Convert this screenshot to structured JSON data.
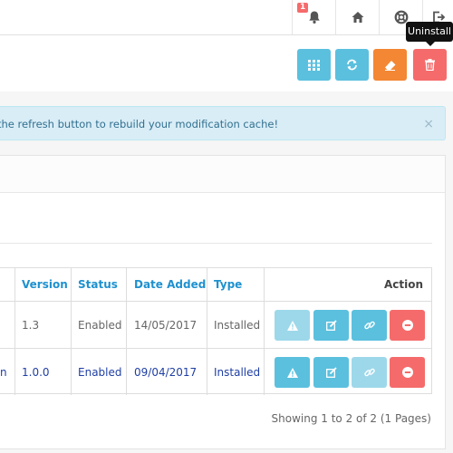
{
  "topbar": {
    "notification_count": "1",
    "tooltip": "Uninstall",
    "icons": [
      "bell-icon",
      "home-icon",
      "lifebuoy-icon",
      "logout-icon"
    ]
  },
  "header_actions": [
    {
      "icon": "filter-icon",
      "color": "#5bc0de"
    },
    {
      "icon": "refresh-icon",
      "color": "#5bc0de"
    },
    {
      "icon": "eraser-icon",
      "color": "#f38733"
    },
    {
      "icon": "trash-icon",
      "color": "#f56b6b"
    }
  ],
  "alert": {
    "text": "the refresh button to rebuild your modification cache!",
    "close": "×"
  },
  "table": {
    "headers": {
      "version": "Version",
      "status": "Status",
      "date_added": "Date Added",
      "type": "Type",
      "action": "Action"
    },
    "rows": [
      {
        "name_suffix": "",
        "version": "1.3",
        "status": "Enabled",
        "date_added": "14/05/2017",
        "type": "Installed"
      },
      {
        "name_suffix": "n",
        "version": "1.0.0",
        "status": "Enabled",
        "date_added": "09/04/2017",
        "type": "Installed"
      }
    ]
  },
  "pagination": {
    "text": "Showing 1 to 2 of 2 (1 Pages)"
  },
  "colors": {
    "info": "#5bc0de",
    "danger": "#f56b6b",
    "warning": "#f38733",
    "link": "#1e91cf",
    "active_row_text": "#1f3fa4"
  }
}
